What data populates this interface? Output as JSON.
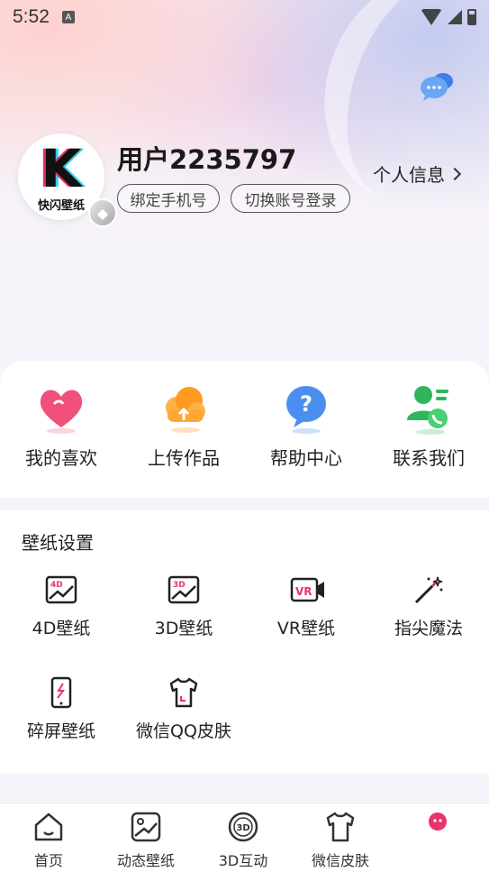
{
  "status_bar": {
    "time": "5:52",
    "notification_icon": "A"
  },
  "header": {
    "message_icon": "chat-bubble-icon"
  },
  "profile": {
    "avatar_text": "K",
    "avatar_subtext": "快闪壁纸",
    "username": "用户2235797",
    "bind_phone_label": "绑定手机号",
    "switch_account_label": "切换账号登录",
    "personal_info_label": "个人信息"
  },
  "quick_actions": [
    {
      "label": "我的喜欢",
      "icon": "heart-icon"
    },
    {
      "label": "上传作品",
      "icon": "cloud-upload-icon"
    },
    {
      "label": "帮助中心",
      "icon": "help-icon"
    },
    {
      "label": "联系我们",
      "icon": "contact-icon"
    }
  ],
  "wallpaper_settings": {
    "title": "壁纸设置",
    "items": [
      {
        "label": "4D壁纸",
        "icon": "4d-wallpaper-icon"
      },
      {
        "label": "3D壁纸",
        "icon": "3d-wallpaper-icon"
      },
      {
        "label": "VR壁纸",
        "icon": "vr-camera-icon"
      },
      {
        "label": "指尖魔法",
        "icon": "magic-wand-icon"
      },
      {
        "label": "碎屏壁纸",
        "icon": "broken-phone-icon"
      },
      {
        "label": "微信QQ皮肤",
        "icon": "tshirt-icon"
      }
    ]
  },
  "tabbar": {
    "tabs": [
      {
        "label": "首页",
        "icon": "home-icon"
      },
      {
        "label": "动态壁纸",
        "icon": "live-wallpaper-icon"
      },
      {
        "label": "3D互动",
        "icon": "3d-interactive-icon"
      },
      {
        "label": "微信皮肤",
        "icon": "tshirt-icon"
      },
      {
        "label": "",
        "icon": "mine-icon"
      }
    ]
  },
  "colors": {
    "accent_pink": "#e8336b",
    "primary_text": "#222222",
    "background": "#f3f5fa"
  }
}
